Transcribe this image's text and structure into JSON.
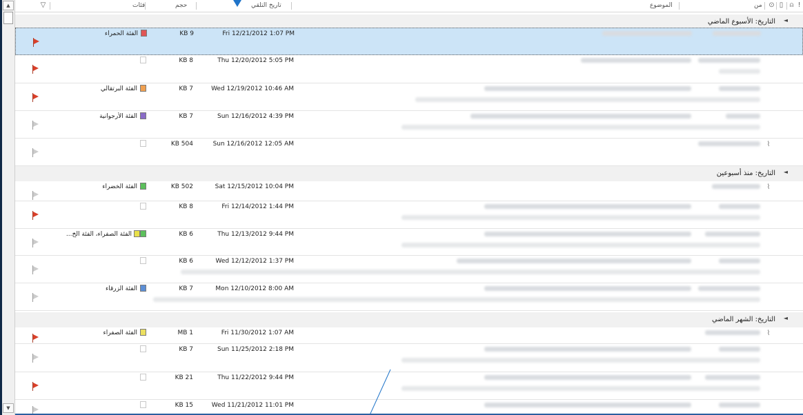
{
  "header": {
    "categories_label": "فئات",
    "size_label": "حجم",
    "received_label": "تاريخ التلقي",
    "subject_label": "الموضوع",
    "from_label": "من",
    "filter_icon": "filter-icon",
    "sort_icon": "sort-down-arrow-icon"
  },
  "scrollbar": {
    "up_glyph": "▲",
    "down_glyph": "▼"
  },
  "groups": [
    {
      "title": "التاريخ: الأسبوع الماضي",
      "collapse_glyph": "◄"
    },
    {
      "title": "التاريخ: منذ أسبوعين",
      "collapse_glyph": "◄"
    },
    {
      "title": "التاريخ: الشهر الماضي",
      "collapse_glyph": "◄"
    }
  ],
  "messages": [
    {
      "flag": "red",
      "category": "الفئة الحمراء",
      "category_colors": [
        "#e05555"
      ],
      "size": "KB 9",
      "received": "Fri 12/21/2012 1:07 PM"
    },
    {
      "flag": "red",
      "category": "",
      "category_colors": [],
      "size": "KB 8",
      "received": "Thu 12/20/2012 5:05 PM"
    },
    {
      "flag": "red",
      "category": "الفئة البرتقالي",
      "category_colors": [
        "#f0a050"
      ],
      "size": "KB 7",
      "received": "Wed 12/19/2012 10:46 AM"
    },
    {
      "flag": "grey",
      "category": "الفئة الأرجوانية",
      "category_colors": [
        "#8a6cc8"
      ],
      "size": "KB 7",
      "received": "Sun 12/16/2012 4:39 PM"
    },
    {
      "flag": "grey",
      "category": "",
      "category_colors": [],
      "size": "KB 504",
      "received": "Sun 12/16/2012 12:05 AM"
    },
    {
      "flag": "grey",
      "category": "الفئة الخضراء",
      "category_colors": [
        "#5cc05c"
      ],
      "size": "KB 502",
      "received": "Sat 12/15/2012 10:04 PM"
    },
    {
      "flag": "red",
      "category": "",
      "category_colors": [],
      "size": "KB 8",
      "received": "Fri 12/14/2012 1:44 PM"
    },
    {
      "flag": "grey",
      "category": "الفئة الصفراء، الفئة الخ...",
      "category_colors": [
        "#e8e04a",
        "#5cc05c"
      ],
      "size": "KB 6",
      "received": "Thu 12/13/2012 9:44 PM"
    },
    {
      "flag": "grey",
      "category": "",
      "category_colors": [],
      "size": "KB 6",
      "received": "Wed 12/12/2012 1:37 PM"
    },
    {
      "flag": "grey",
      "category": "الفئة الزرقاء",
      "category_colors": [
        "#5c8fd6"
      ],
      "size": "KB 7",
      "received": "Mon 12/10/2012 8:00 AM"
    },
    {
      "flag": "red",
      "category": "الفئة الصفراء",
      "category_colors": [
        "#ece060"
      ],
      "size": "MB 1",
      "received": "Fri 11/30/2012 1:07 AM"
    },
    {
      "flag": "grey",
      "category": "",
      "category_colors": [],
      "size": "KB 7",
      "received": "Sun 11/25/2012 2:18 PM"
    },
    {
      "flag": "red",
      "category": "",
      "category_colors": [],
      "size": "KB 21",
      "received": "Thu 11/22/2012 9:44 PM"
    },
    {
      "flag": "grey",
      "category": "",
      "category_colors": [],
      "size": "KB 15",
      "received": "Wed 11/21/2012 11:01 PM"
    }
  ],
  "colors": {
    "selection": "#cce4f7",
    "red_flag": "#d9402a",
    "sort_arrow": "#1f74c9"
  }
}
